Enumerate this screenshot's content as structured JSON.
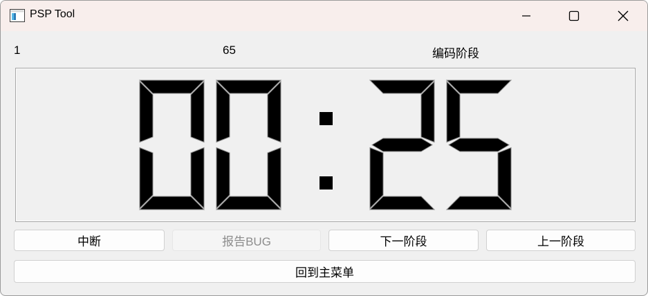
{
  "window": {
    "title": "PSP Tool"
  },
  "info_row": {
    "left_value": "1",
    "middle_value": "65",
    "phase": "编码阶段"
  },
  "timer": {
    "display": "00:25",
    "digits": [
      "0",
      "0",
      "2",
      "5"
    ]
  },
  "buttons": {
    "interrupt": "中断",
    "report_bug": "报告BUG",
    "next_phase": "下一阶段",
    "prev_phase": "上一阶段",
    "back_to_menu": "回到主菜单"
  },
  "icons": {
    "app": "app-window-icon",
    "minimize": "minimize-icon",
    "maximize": "maximize-icon",
    "close": "close-icon"
  }
}
